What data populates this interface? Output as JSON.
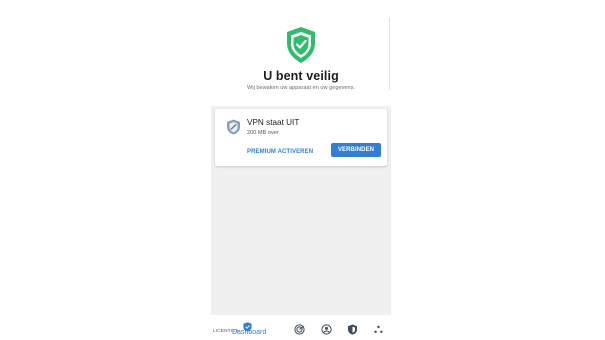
{
  "hero": {
    "title": "U bent veilig",
    "subtitle": "Wij bewaken uw apparaat en uw gegevens.",
    "icon": "shield-check-icon"
  },
  "vpn_card": {
    "icon": "vpn-shield-icon",
    "title": "VPN staat UIT",
    "data_left": "200 MB over",
    "premium_label": "PREMIUM ACTIVEREN",
    "connect_label": "VERBINDEN"
  },
  "bottom_nav": {
    "licenses_label": "LICENTIES",
    "dashboard_label": "Dashboard",
    "items": [
      {
        "icon": "dashboard-shield-icon",
        "active": true
      },
      {
        "icon": "scan-target-icon"
      },
      {
        "icon": "privacy-icon"
      },
      {
        "icon": "protection-shield-icon"
      },
      {
        "icon": "more-dots-icon"
      }
    ]
  },
  "colors": {
    "accent": "#2f7fd8",
    "safe_green": "#2ebd6b",
    "background": "#f0f0f0"
  }
}
